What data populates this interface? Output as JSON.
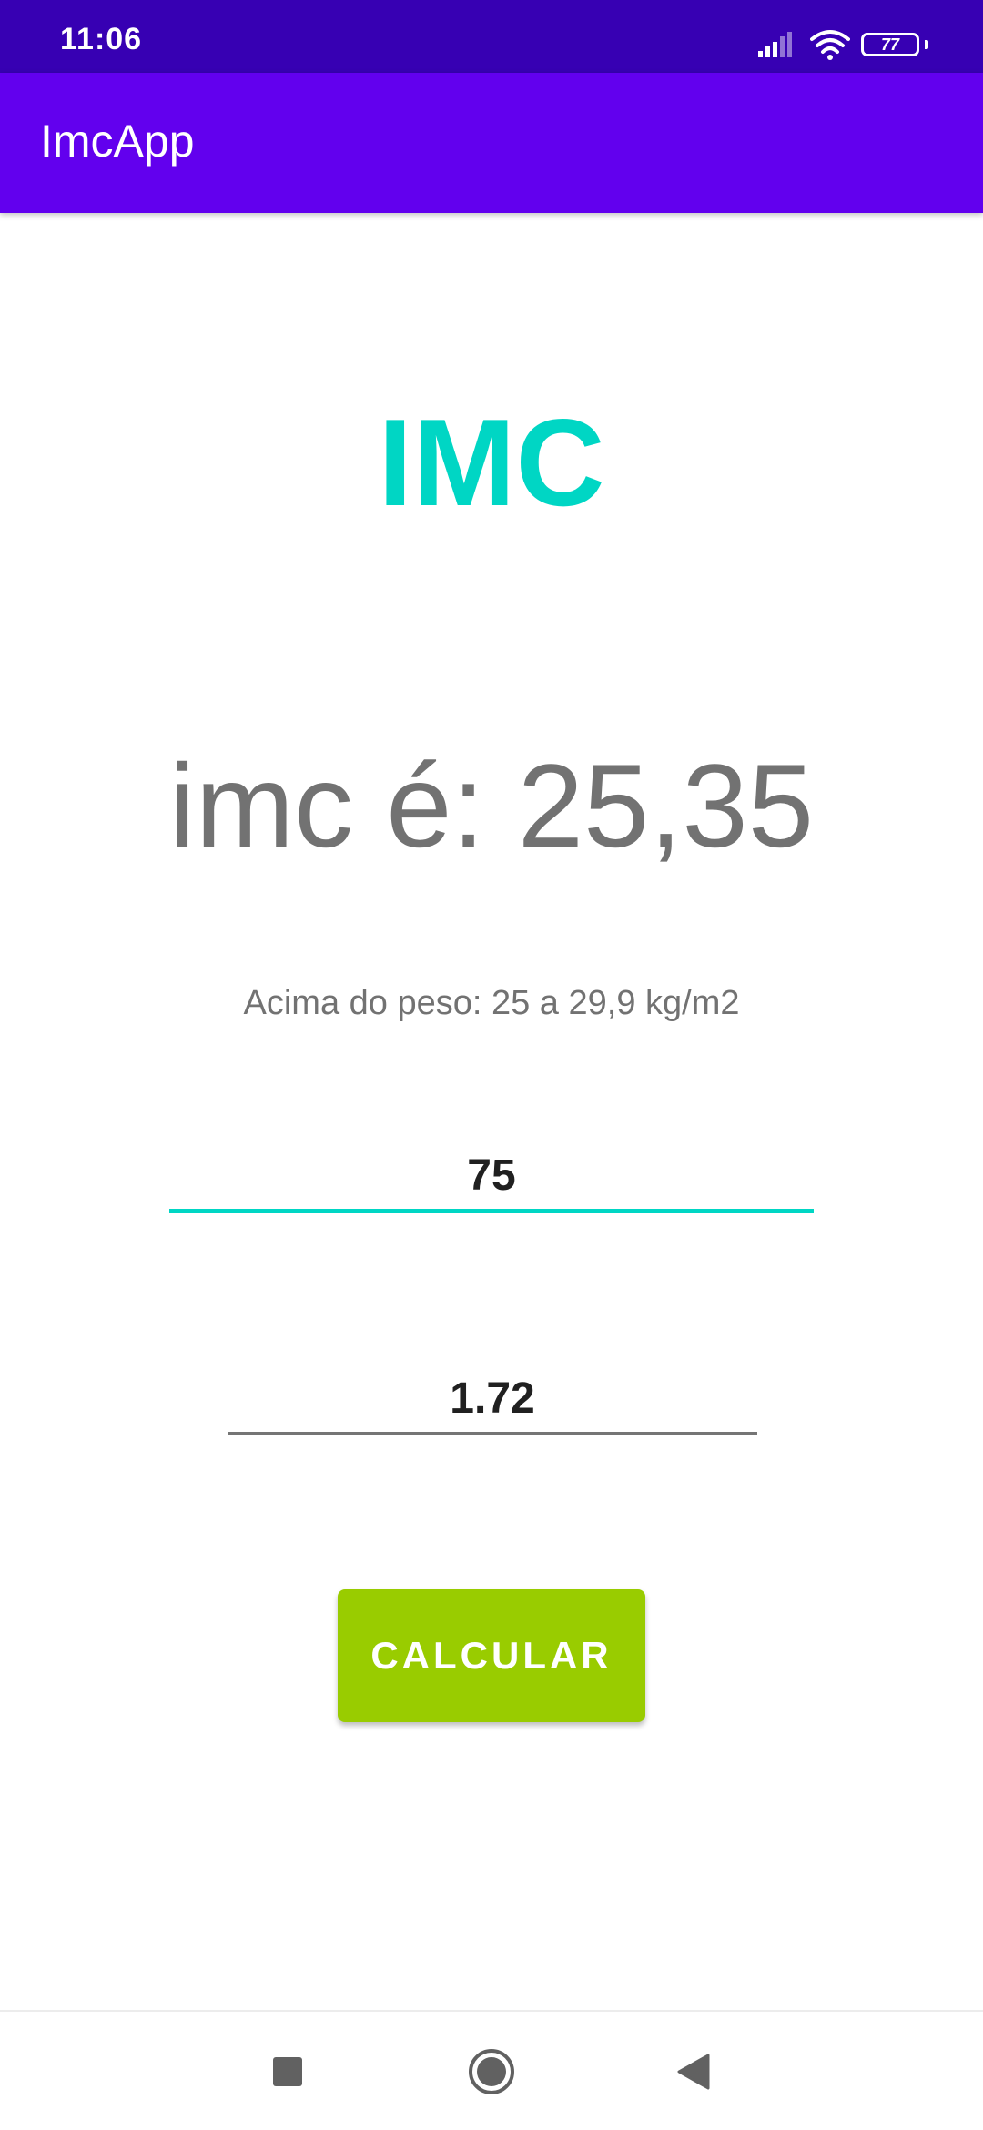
{
  "status_bar": {
    "time": "11:06",
    "battery_level": "77",
    "icons": [
      "signal-icon",
      "wifi-icon",
      "battery-icon"
    ]
  },
  "app_bar": {
    "title": "ImcApp"
  },
  "main": {
    "title": "IMC",
    "result": "imc é: 25,35",
    "category": "Acima do peso: 25 a 29,9 kg/m2",
    "weight_value": "75",
    "height_value": "1.72",
    "calculate_label": "CALCULAR"
  },
  "nav_bar": {
    "icons": [
      "recents-icon",
      "home-icon",
      "back-icon"
    ]
  },
  "colors": {
    "status_bar": "#3700b3",
    "app_bar": "#6200ee",
    "accent": "#00d6c4",
    "button": "#99cc00",
    "text_gray": "#727272"
  }
}
